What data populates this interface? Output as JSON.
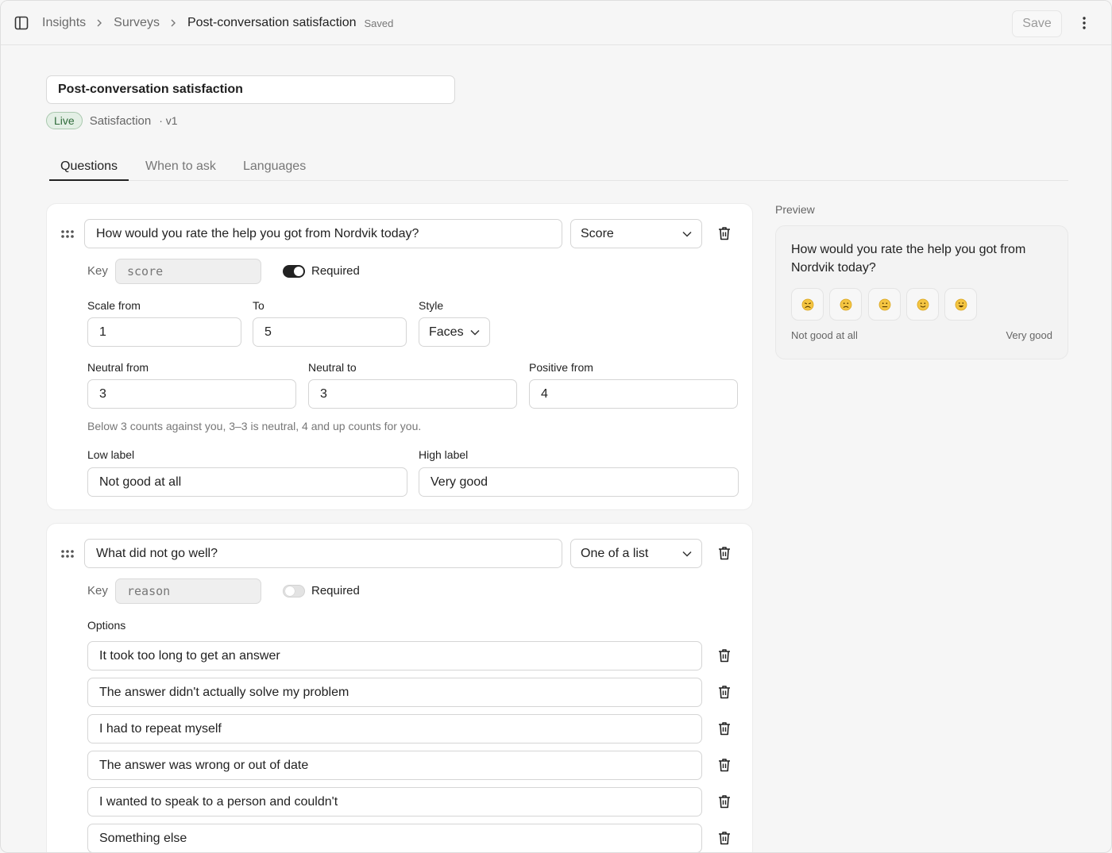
{
  "breadcrumbs": [
    "Insights",
    "Surveys",
    "Post-conversation satisfaction"
  ],
  "saved_status": "Saved",
  "save_label": "Save",
  "survey": {
    "title": "Post-conversation satisfaction",
    "status": "Live",
    "category": "Satisfaction",
    "version": "· v1"
  },
  "tabs": [
    "Questions",
    "When to ask",
    "Languages"
  ],
  "q1": {
    "text": "How would you rate the help you got from Nordvik today?",
    "type": "Score",
    "key_label": "Key",
    "key": "score",
    "required_label": "Required",
    "required": true,
    "scale_from_label": "Scale from",
    "scale_from": "1",
    "to_label": "To",
    "to": "5",
    "style_label": "Style",
    "style": "Faces",
    "neutral_from_label": "Neutral from",
    "neutral_from": "3",
    "neutral_to_label": "Neutral to",
    "neutral_to": "3",
    "positive_from_label": "Positive from",
    "positive_from": "4",
    "hint": "Below 3 counts against you, 3–3 is neutral, 4 and up counts for you.",
    "low_label_label": "Low label",
    "low_label": "Not good at all",
    "high_label_label": "High label",
    "high_label": "Very good"
  },
  "q2": {
    "text": "What did not go well?",
    "type": "One of a list",
    "key_label": "Key",
    "key": "reason",
    "required_label": "Required",
    "required": false,
    "options_label": "Options",
    "options": [
      "It took too long to get an answer",
      "The answer didn't actually solve my problem",
      "I had to repeat myself",
      "The answer was wrong or out of date",
      "I wanted to speak to a person and couldn't",
      "Something else"
    ]
  },
  "preview": {
    "heading": "Preview",
    "question": "How would you rate the help you got from Nordvik today?",
    "faces": [
      "very-unhappy-face-icon",
      "unhappy-face-icon",
      "neutral-face-icon",
      "slightly-happy-face-icon",
      "happy-face-icon"
    ],
    "low": "Not good at all",
    "high": "Very good"
  }
}
